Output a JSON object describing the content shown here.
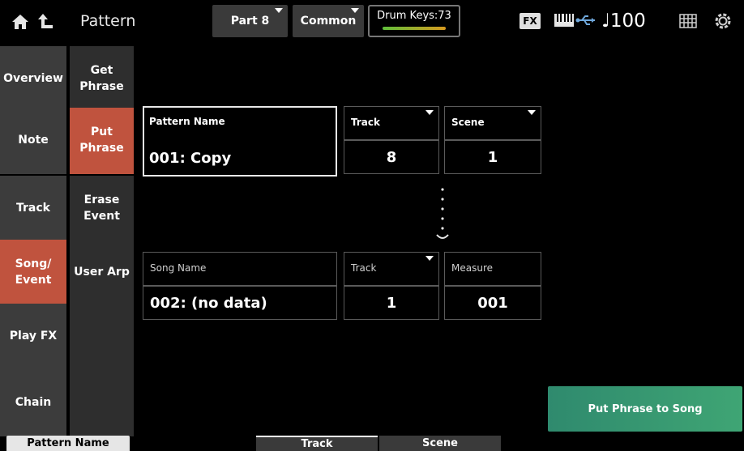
{
  "header": {
    "title": "Pattern",
    "part_label": "Part 8",
    "common_label": "Common",
    "drum_keys_label": "Drum Keys:73",
    "fx_badge": "FX",
    "tempo": "♩100"
  },
  "left_tabs": [
    "Overview",
    "Note",
    "Track",
    "Song/\nEvent",
    "Play FX",
    "Chain"
  ],
  "sub_tabs": [
    "Get\nPhrase",
    "Put\nPhrase",
    "Erase\nEvent",
    "User Arp"
  ],
  "source": {
    "pattern_name_header": "Pattern Name",
    "track_header": "Track",
    "scene_header": "Scene",
    "pattern_name_value": "001: Copy",
    "track_value": "8",
    "scene_value": "1"
  },
  "destination": {
    "song_name_header": "Song Name",
    "track_header": "Track",
    "measure_header": "Measure",
    "song_name_value": "002: (no data)",
    "track_value": "1",
    "measure_value": "001"
  },
  "action_button": "Put Phrase to Song",
  "bottom_tabs": {
    "pattern_name": "Pattern Name",
    "track": "Track",
    "scene": "Scene"
  },
  "colors": {
    "active_tab": "#c0533e",
    "action_green": "#3a9e72"
  }
}
